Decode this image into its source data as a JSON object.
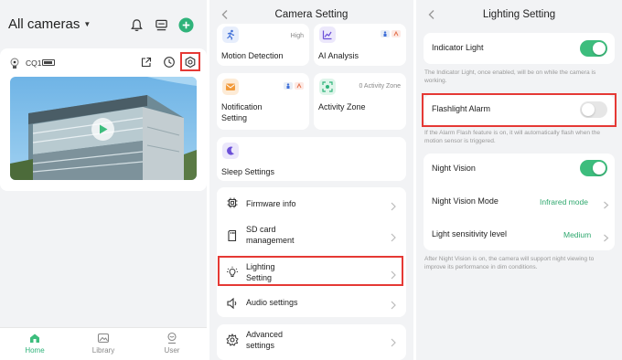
{
  "panel1": {
    "title": "All cameras",
    "camera": {
      "name": "CQ1"
    },
    "tabs": [
      {
        "label": "Home",
        "active": true
      },
      {
        "label": "Library",
        "active": false
      },
      {
        "label": "User",
        "active": false
      }
    ],
    "accent": "#2fb37a",
    "highlight": "#e53935"
  },
  "panel2": {
    "title": "Camera Setting",
    "tiles": {
      "motion": {
        "label": "Motion Detection",
        "badge": "High"
      },
      "ai": {
        "label": "AI Analysis"
      },
      "notification": {
        "label_line1": "Notification",
        "label_line2": "Setting"
      },
      "activity": {
        "label": "Activity Zone",
        "badge": "0 Activity Zone"
      },
      "sleep": {
        "label": "Sleep Settings"
      }
    },
    "list1": {
      "firmware": "Firmware info",
      "sd_line1": "SD card",
      "sd_line2": "management",
      "lighting_line1": "Lighting",
      "lighting_line2": "Setting",
      "audio": "Audio settings"
    },
    "list2": {
      "advanced_line1": "Advanced",
      "advanced_line2": "settings"
    }
  },
  "panel3": {
    "title": "Lighting Setting",
    "indicator": {
      "label": "Indicator Light",
      "on": true,
      "hint": "The Indicator Light, once enabled, will be on while the camera is working."
    },
    "flashlight": {
      "label": "Flashlight Alarm",
      "on": false,
      "hint": "If the Alarm Flash feature is on, it will automatically flash when the motion sensor is triggered."
    },
    "night_vision": {
      "label": "Night Vision",
      "on": true
    },
    "night_mode": {
      "label": "Night Vision Mode",
      "value": "Infrared mode"
    },
    "sensitivity": {
      "label": "Light sensitivity level",
      "value": "Medium"
    },
    "night_hint": "After Night Vision is on, the camera will support night viewing to improve its performance in dim conditions."
  }
}
